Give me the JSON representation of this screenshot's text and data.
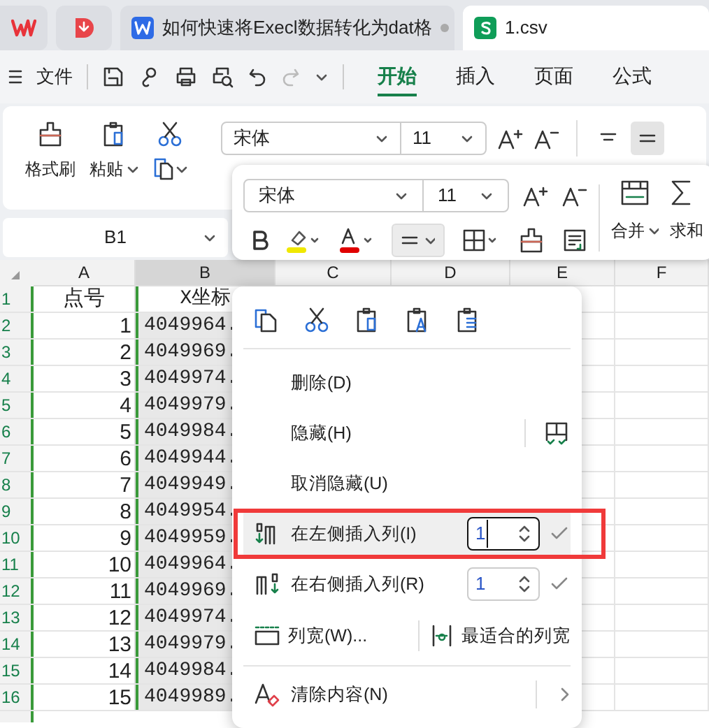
{
  "tabs": [
    {
      "kind": "wps",
      "selected": false
    },
    {
      "kind": "pdf",
      "selected": false
    },
    {
      "kind": "doc",
      "label": "如何快速将Execl数据转化为dat格",
      "selected": false
    },
    {
      "kind": "sheet",
      "label": "1.csv",
      "selected": true
    }
  ],
  "menu_bar": {
    "file": "文件",
    "tabs": [
      {
        "label": "开始",
        "selected": true
      },
      {
        "label": "插入",
        "selected": false
      },
      {
        "label": "页面",
        "selected": false
      },
      {
        "label": "公式",
        "selected": false
      }
    ]
  },
  "ribbon": {
    "format_painter": "格式刷",
    "paste": "粘贴",
    "font": "宋体",
    "size": "11"
  },
  "mini_toolbar": {
    "font": "宋体",
    "size": "11",
    "merge": "合并",
    "sum": "求和"
  },
  "name_box": "B1",
  "sheet": {
    "columns": [
      {
        "label": "A",
        "selected": false
      },
      {
        "label": "B",
        "selected": true
      },
      {
        "label": "C",
        "selected": false
      },
      {
        "label": "D",
        "selected": false
      },
      {
        "label": "E",
        "selected": false
      },
      {
        "label": "F",
        "selected": false
      }
    ],
    "rows": [
      {
        "number": "1",
        "a": "点号",
        "b": "X坐标"
      },
      {
        "number": "2",
        "a": "1",
        "b": "4049964."
      },
      {
        "number": "3",
        "a": "2",
        "b": "4049969."
      },
      {
        "number": "4",
        "a": "3",
        "b": "4049974."
      },
      {
        "number": "5",
        "a": "4",
        "b": "4049979."
      },
      {
        "number": "6",
        "a": "5",
        "b": "4049984."
      },
      {
        "number": "7",
        "a": "6",
        "b": "4049944."
      },
      {
        "number": "8",
        "a": "7",
        "b": "4049949."
      },
      {
        "number": "9",
        "a": "8",
        "b": "4049954."
      },
      {
        "number": "10",
        "a": "9",
        "b": "4049959."
      },
      {
        "number": "11",
        "a": "10",
        "b": "4049964."
      },
      {
        "number": "12",
        "a": "11",
        "b": "4049969."
      },
      {
        "number": "13",
        "a": "12",
        "b": "4049974."
      },
      {
        "number": "14",
        "a": "13",
        "b": "4049979."
      },
      {
        "number": "15",
        "a": "14",
        "b": "4049984."
      },
      {
        "number": "16",
        "a": "15",
        "b": "4049989."
      }
    ]
  },
  "context_menu": {
    "items": [
      {
        "kind": "plain",
        "label": "删除(D)"
      },
      {
        "kind": "hide",
        "label": "隐藏(H)"
      },
      {
        "kind": "plain",
        "label": "取消隐藏(U)"
      },
      {
        "kind": "insert_left",
        "label": "在左侧插入列(I)",
        "value": "1",
        "selected": true
      },
      {
        "kind": "insert_right",
        "label": "在右侧插入列(R)",
        "value": "1",
        "selected": false
      },
      {
        "kind": "width",
        "label": "列宽(W)...",
        "side_label": "最适合的列宽"
      },
      {
        "kind": "clear",
        "label": "清除内容(N)"
      }
    ]
  }
}
